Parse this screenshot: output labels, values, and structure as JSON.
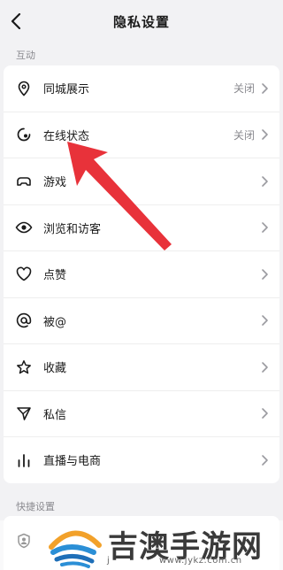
{
  "header": {
    "title": "隐私设置"
  },
  "sections": {
    "interaction": "互动",
    "quick": "快捷设置"
  },
  "items": [
    {
      "label": "同城展示",
      "value": "关闭",
      "icon": "location-pin-icon"
    },
    {
      "label": "在线状态",
      "value": "关闭",
      "icon": "online-status-icon"
    },
    {
      "label": "游戏",
      "value": "",
      "icon": "game-controller-icon"
    },
    {
      "label": "浏览和访客",
      "value": "",
      "icon": "eye-icon"
    },
    {
      "label": "点赞",
      "value": "",
      "icon": "heart-icon"
    },
    {
      "label": "被@",
      "value": "",
      "icon": "at-icon"
    },
    {
      "label": "收藏",
      "value": "",
      "icon": "star-icon"
    },
    {
      "label": "私信",
      "value": "",
      "icon": "send-icon"
    },
    {
      "label": "直播与电商",
      "value": "",
      "icon": "bar-chart-icon"
    }
  ],
  "annotation": {
    "color": "#e8323a"
  },
  "watermark": {
    "text": "吉澳手游网",
    "url": "www.jykz.com.cn",
    "fragment": "j"
  }
}
